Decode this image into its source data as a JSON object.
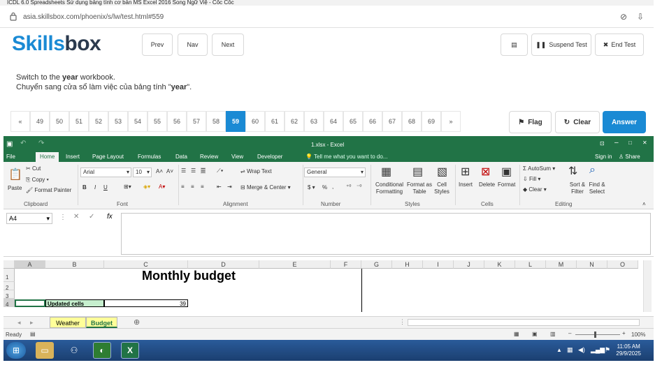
{
  "browser": {
    "window_title": "ICDL 6.0 Spreadsheets Sử dụng bảng tính cơ bản MS Excel 2016 Song Ngữ Việ - Cốc Cốc",
    "url": "asia.skillsbox.com/phoenix/s/lw/test.html#559"
  },
  "test": {
    "logo_part1": "Skills",
    "logo_part2": "box",
    "prev_label": "Prev",
    "nav_label": "Nav",
    "next_label": "Next",
    "suspend_label": "Suspend Test",
    "end_label": "End Test",
    "question_en_pre": "Switch to the ",
    "question_en_bold": "year",
    "question_en_post": " workbook.",
    "question_vi_pre": "Chuyển sang cửa sổ làm việc của bảng tính \"",
    "question_vi_bold": "year",
    "question_vi_post": "\".",
    "pager_first": "«",
    "pager_last": "»",
    "pages": [
      "49",
      "50",
      "51",
      "52",
      "53",
      "54",
      "55",
      "56",
      "57",
      "58",
      "59",
      "60",
      "61",
      "62",
      "63",
      "64",
      "65",
      "66",
      "67",
      "68",
      "69"
    ],
    "current_page": "59",
    "flag_label": "Flag",
    "clear_label": "Clear",
    "answer_label": "Answer",
    "accent_color": "#1a8ad4"
  },
  "excel": {
    "title": "1.xlsx - Excel",
    "tabs": [
      "File",
      "Home",
      "Insert",
      "Page Layout",
      "Formulas",
      "Data",
      "Review",
      "View",
      "Developer"
    ],
    "tell_me": "Tell me what you want to do...",
    "sign_in": "Sign in",
    "share": "Share",
    "clipboard": {
      "paste": "Paste",
      "cut": "Cut",
      "copy": "Copy",
      "format_painter": "Format Painter",
      "label": "Clipboard"
    },
    "font": {
      "name": "Arial",
      "size": "10",
      "label": "Font",
      "bold": "B",
      "italic": "I",
      "underline": "U"
    },
    "alignment": {
      "wrap": "Wrap Text",
      "merge": "Merge & Center",
      "label": "Alignment"
    },
    "number": {
      "format": "General",
      "label": "Number",
      "currency": "$",
      "percent": "%"
    },
    "styles": {
      "cond": "Conditional Formatting",
      "table": "Format as Table",
      "cell": "Cell Styles",
      "label": "Styles"
    },
    "cells": {
      "insert": "Insert",
      "delete": "Delete",
      "format": "Format",
      "label": "Cells"
    },
    "editing": {
      "autosum": "AutoSum",
      "fill": "Fill",
      "clear": "Clear",
      "sort": "Sort & Filter",
      "find": "Find & Select",
      "label": "Editing"
    },
    "name_box": "A4",
    "columns": [
      "A",
      "B",
      "C",
      "D",
      "E",
      "F",
      "G",
      "H",
      "I",
      "J",
      "K",
      "L",
      "M",
      "N",
      "O"
    ],
    "rows": [
      "1",
      "2",
      "3",
      "4"
    ],
    "cell_title": "Monthly budget",
    "cell_b4": "Updated cells",
    "cell_c4": "39",
    "sheets": [
      "Weather",
      "Budget"
    ],
    "status_ready": "Ready",
    "zoom": "100%",
    "green": "#217346"
  },
  "taskbar": {
    "time": "11:05 AM",
    "date": "29/9/2025"
  }
}
